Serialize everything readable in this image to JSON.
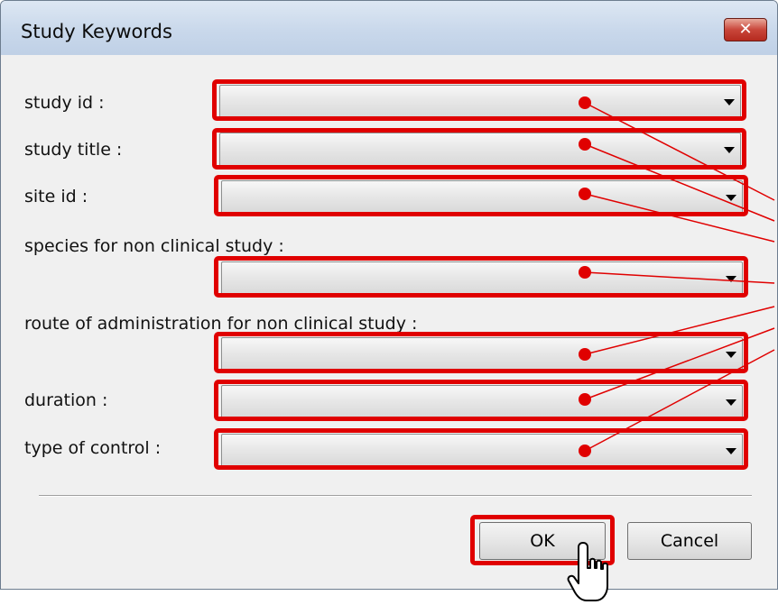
{
  "window": {
    "title": "Study Keywords",
    "close_glyph": "✕"
  },
  "fields": [
    {
      "label": "study id :",
      "value": ""
    },
    {
      "label": "study title :",
      "value": ""
    },
    {
      "label": "site id :",
      "value": ""
    },
    {
      "label": "species for non clinical study :",
      "value": ""
    },
    {
      "label": "route of administration for non clinical study :",
      "value": ""
    },
    {
      "label": "duration :",
      "value": ""
    },
    {
      "label": "type of control :",
      "value": ""
    }
  ],
  "buttons": {
    "ok": "OK",
    "cancel": "Cancel"
  },
  "annotation": {
    "highlight_color": "#e00000",
    "cursor": "hand-pointer-icon"
  }
}
